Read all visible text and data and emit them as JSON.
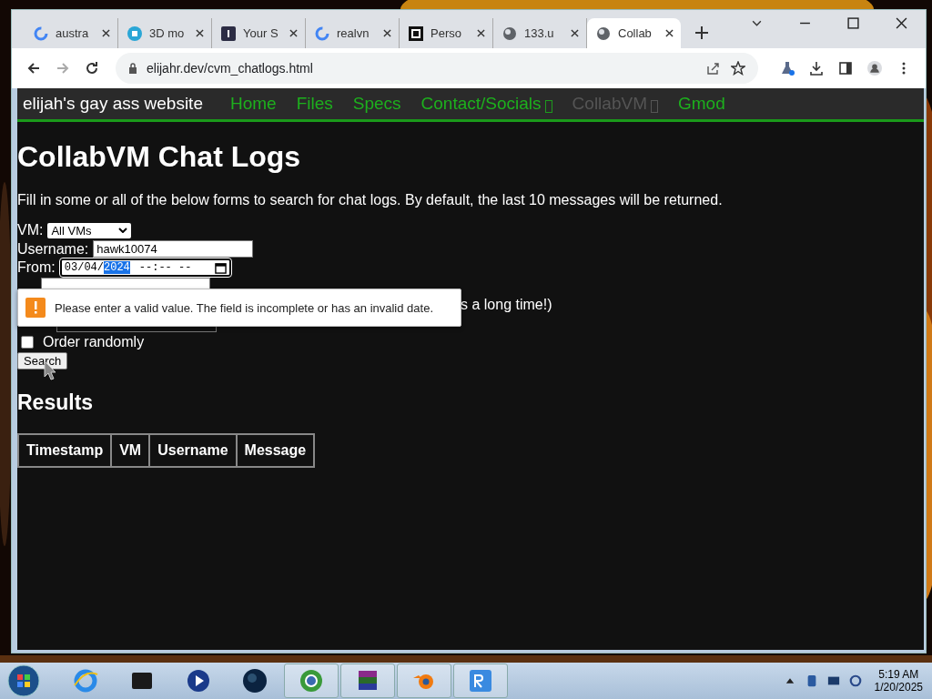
{
  "browser": {
    "tabs": [
      {
        "title": "austra",
        "kind": "google",
        "selected": false
      },
      {
        "title": "3D mo",
        "kind": "cube",
        "selected": false
      },
      {
        "title": "Your S",
        "kind": "number",
        "selected": false
      },
      {
        "title": "realvn",
        "kind": "google",
        "selected": false
      },
      {
        "title": "Perso",
        "kind": "square",
        "selected": false
      },
      {
        "title": "133.u",
        "kind": "globe",
        "selected": false
      },
      {
        "title": "Collab",
        "kind": "globe",
        "selected": true
      }
    ],
    "url": "elijahr.dev/cvm_chatlogs.html"
  },
  "site": {
    "brand": "elijah's gay ass website",
    "nav": [
      {
        "label": "Home",
        "selected": false,
        "glyph": false
      },
      {
        "label": "Files",
        "selected": false,
        "glyph": false
      },
      {
        "label": "Specs",
        "selected": false,
        "glyph": false
      },
      {
        "label": "Contact/Socials",
        "selected": false,
        "glyph": true
      },
      {
        "label": "CollabVM",
        "selected": true,
        "glyph": true
      },
      {
        "label": "Gmod",
        "selected": false,
        "glyph": false
      }
    ]
  },
  "page": {
    "title": "CollabVM Chat Logs",
    "intro": "Fill in some or all of the below forms to search for chat logs. By default, the last 10 messages will be returned.",
    "vm": {
      "label": "VM:",
      "value": "All VMs"
    },
    "username": {
      "label": "Username:",
      "value": "hawk10074"
    },
    "from": {
      "label": "From:",
      "date": "03/04/",
      "year": "2024",
      "time": "--:-- --"
    },
    "hidden_note": "s a long time!)",
    "order": {
      "label": "Order randomly",
      "checked": false
    },
    "search_button": "Search",
    "tooltip": "Please enter a valid value. The field is incomplete or has an invalid date.",
    "results_title": "Results",
    "columns": [
      "Timestamp",
      "VM",
      "Username",
      "Message"
    ]
  },
  "taskbar": {
    "apps": [
      {
        "kind": "ie",
        "running": false
      },
      {
        "kind": "box",
        "running": false
      },
      {
        "kind": "media",
        "running": false
      },
      {
        "kind": "globe",
        "running": false
      },
      {
        "kind": "chrome",
        "running": true
      },
      {
        "kind": "rar",
        "running": true
      },
      {
        "kind": "blender",
        "running": true
      },
      {
        "kind": "vnc",
        "running": true
      }
    ],
    "time": "5:19 AM",
    "date": "1/20/2025"
  }
}
